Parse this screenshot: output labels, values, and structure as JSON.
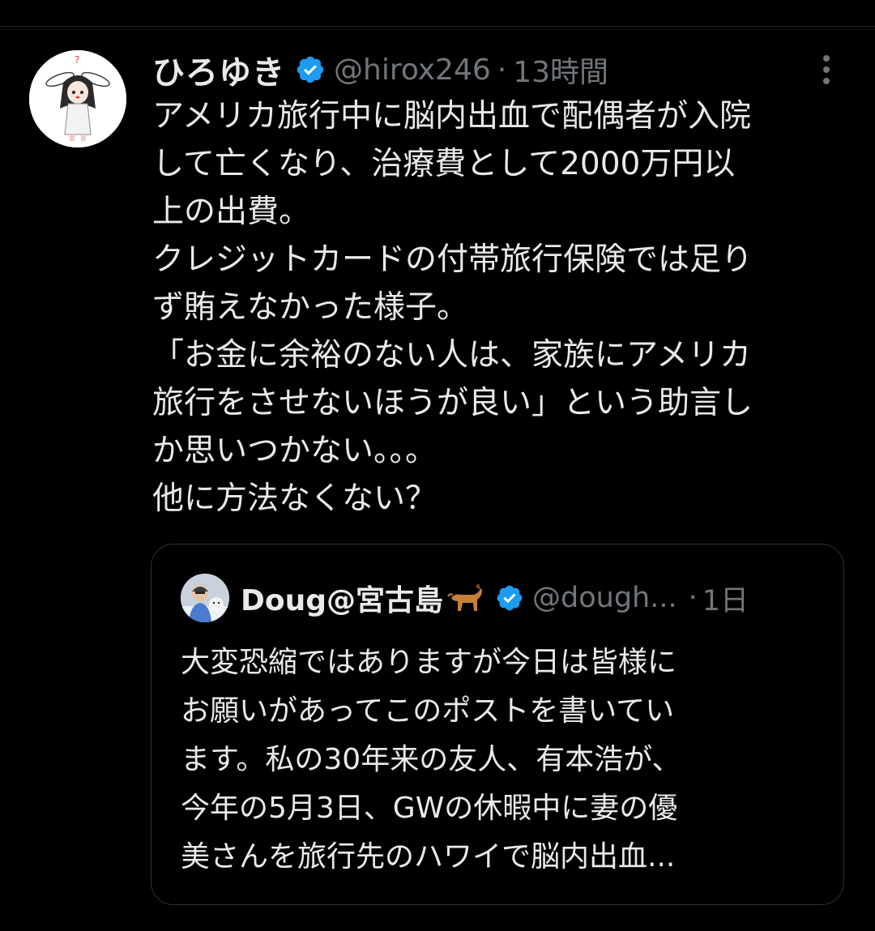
{
  "post": {
    "author": {
      "name": "ひろゆき",
      "handle": "@hirox246",
      "time": "13時間",
      "verified": true
    },
    "text_lines": [
      "アメリカ旅行中に脳内出血で配偶者が入院",
      "して亡くなり、治療費として2000万円以",
      "上の出費。",
      "クレジットカードの付帯旅行保険では足り",
      "ず賄えなかった様子。",
      "「お金に余裕のない人は、家族にアメリカ",
      "旅行をさせないほうが良い」という助言し",
      "か思いつかない。。。",
      "他に方法なくない？"
    ],
    "separator_dot": "·"
  },
  "quote": {
    "author": {
      "name": "Doug@宮古島",
      "emoji": "dog-emoji",
      "handle": "@dough...",
      "time": "1日",
      "verified": true
    },
    "text_lines": [
      "大変恐縮ではありますが今日は皆様に",
      "お願いがあってこのポストを書いてい",
      "ます。私の30年来の友人、有本浩が、",
      "今年の5月3日、GWの休暇中に妻の優",
      "美さんを旅行先のハワイで脳内出血..."
    ]
  },
  "icons": {
    "verified_badge": "verified-badge-icon",
    "more": "more-options-icon"
  },
  "colors": {
    "background": "#000000",
    "primary_text": "#e7e9ea",
    "secondary_text": "#71767b",
    "verified_blue": "#1d9bf0",
    "border": "#2f3336"
  }
}
